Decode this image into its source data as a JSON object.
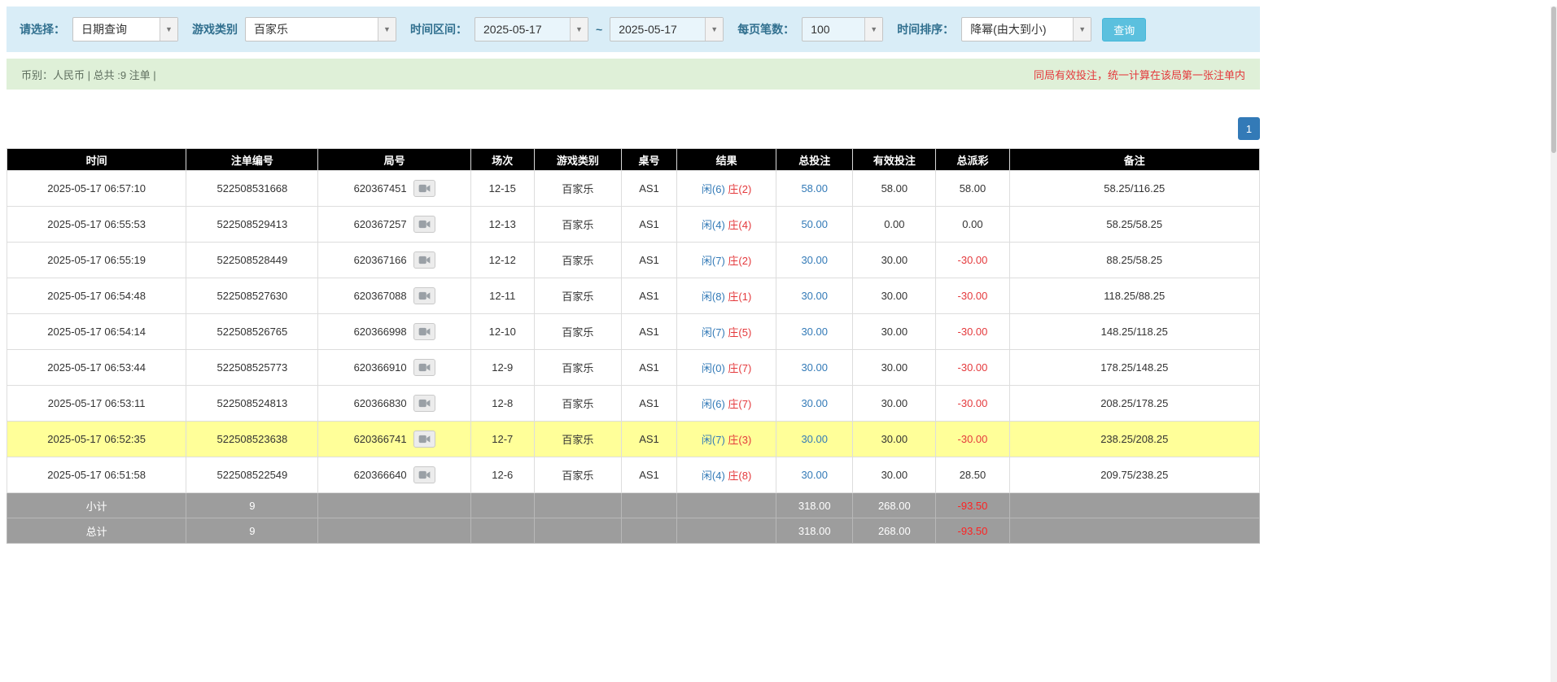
{
  "filter_bar": {
    "select_label": "请选择：",
    "select_value": "日期查询",
    "game_label": "游戏类别",
    "game_value": "百家乐",
    "time_label": "时间区间：",
    "date_from": "2025-05-17",
    "range_separator": "~",
    "date_to": "2025-05-17",
    "per_page_label": "每页笔数：",
    "per_page_value": "100",
    "sort_label": "时间排序：",
    "sort_value": "降幂(由大到小)",
    "query_button": "查询"
  },
  "info_bar": {
    "summary": "币别：人民币 | 总共 :9 注单 |",
    "notice": "同局有效投注，统一计算在该局第一张注单内"
  },
  "pagination": {
    "current_page": "1"
  },
  "table": {
    "headers": [
      "时间",
      "注单编号",
      "局号",
      "场次",
      "游戏类别",
      "桌号",
      "结果",
      "总投注",
      "有效投注",
      "总派彩",
      "备注"
    ],
    "rows": [
      {
        "time": "2025-05-17 06:57:10",
        "bet_id": "522508531668",
        "round_id": "620367451",
        "session": "12-15",
        "game": "百家乐",
        "table_no": "AS1",
        "result_player": "闲(6)",
        "result_banker": "庄(2)",
        "total_bet": "58.00",
        "valid_bet": "58.00",
        "payout": "58.00",
        "remark": "58.25/116.25",
        "highlighted": false
      },
      {
        "time": "2025-05-17 06:55:53",
        "bet_id": "522508529413",
        "round_id": "620367257",
        "session": "12-13",
        "game": "百家乐",
        "table_no": "AS1",
        "result_player": "闲(4)",
        "result_banker": "庄(4)",
        "total_bet": "50.00",
        "valid_bet": "0.00",
        "payout": "0.00",
        "remark": "58.25/58.25",
        "highlighted": false
      },
      {
        "time": "2025-05-17 06:55:19",
        "bet_id": "522508528449",
        "round_id": "620367166",
        "session": "12-12",
        "game": "百家乐",
        "table_no": "AS1",
        "result_player": "闲(7)",
        "result_banker": "庄(2)",
        "total_bet": "30.00",
        "valid_bet": "30.00",
        "payout": "-30.00",
        "remark": "88.25/58.25",
        "highlighted": false
      },
      {
        "time": "2025-05-17 06:54:48",
        "bet_id": "522508527630",
        "round_id": "620367088",
        "session": "12-11",
        "game": "百家乐",
        "table_no": "AS1",
        "result_player": "闲(8)",
        "result_banker": "庄(1)",
        "total_bet": "30.00",
        "valid_bet": "30.00",
        "payout": "-30.00",
        "remark": "118.25/88.25",
        "highlighted": false
      },
      {
        "time": "2025-05-17 06:54:14",
        "bet_id": "522508526765",
        "round_id": "620366998",
        "session": "12-10",
        "game": "百家乐",
        "table_no": "AS1",
        "result_player": "闲(7)",
        "result_banker": "庄(5)",
        "total_bet": "30.00",
        "valid_bet": "30.00",
        "payout": "-30.00",
        "remark": "148.25/118.25",
        "highlighted": false
      },
      {
        "time": "2025-05-17 06:53:44",
        "bet_id": "522508525773",
        "round_id": "620366910",
        "session": "12-9",
        "game": "百家乐",
        "table_no": "AS1",
        "result_player": "闲(0)",
        "result_banker": "庄(7)",
        "total_bet": "30.00",
        "valid_bet": "30.00",
        "payout": "-30.00",
        "remark": "178.25/148.25",
        "highlighted": false
      },
      {
        "time": "2025-05-17 06:53:11",
        "bet_id": "522508524813",
        "round_id": "620366830",
        "session": "12-8",
        "game": "百家乐",
        "table_no": "AS1",
        "result_player": "闲(6)",
        "result_banker": "庄(7)",
        "total_bet": "30.00",
        "valid_bet": "30.00",
        "payout": "-30.00",
        "remark": "208.25/178.25",
        "highlighted": false
      },
      {
        "time": "2025-05-17 06:52:35",
        "bet_id": "522508523638",
        "round_id": "620366741",
        "session": "12-7",
        "game": "百家乐",
        "table_no": "AS1",
        "result_player": "闲(7)",
        "result_banker": "庄(3)",
        "total_bet": "30.00",
        "valid_bet": "30.00",
        "payout": "-30.00",
        "remark": "238.25/208.25",
        "highlighted": true
      },
      {
        "time": "2025-05-17 06:51:58",
        "bet_id": "522508522549",
        "round_id": "620366640",
        "session": "12-6",
        "game": "百家乐",
        "table_no": "AS1",
        "result_player": "闲(4)",
        "result_banker": "庄(8)",
        "total_bet": "30.00",
        "valid_bet": "30.00",
        "payout": "28.50",
        "remark": "209.75/238.25",
        "highlighted": false
      }
    ],
    "subtotal": {
      "label": "小计",
      "count": "9",
      "total_bet": "318.00",
      "valid_bet": "268.00",
      "payout": "-93.50"
    },
    "total": {
      "label": "总计",
      "count": "9",
      "total_bet": "318.00",
      "valid_bet": "268.00",
      "payout": "-93.50"
    }
  },
  "colors": {
    "accent_blue": "#337ab7",
    "banker_red": "#e4393c",
    "highlight_yellow": "#ffff99",
    "header_black": "#000000",
    "footer_gray": "#9d9d9d",
    "filter_bar_blue": "#d9edf7",
    "info_bar_green": "#dff0d8",
    "query_button_cyan": "#5bc0de"
  }
}
